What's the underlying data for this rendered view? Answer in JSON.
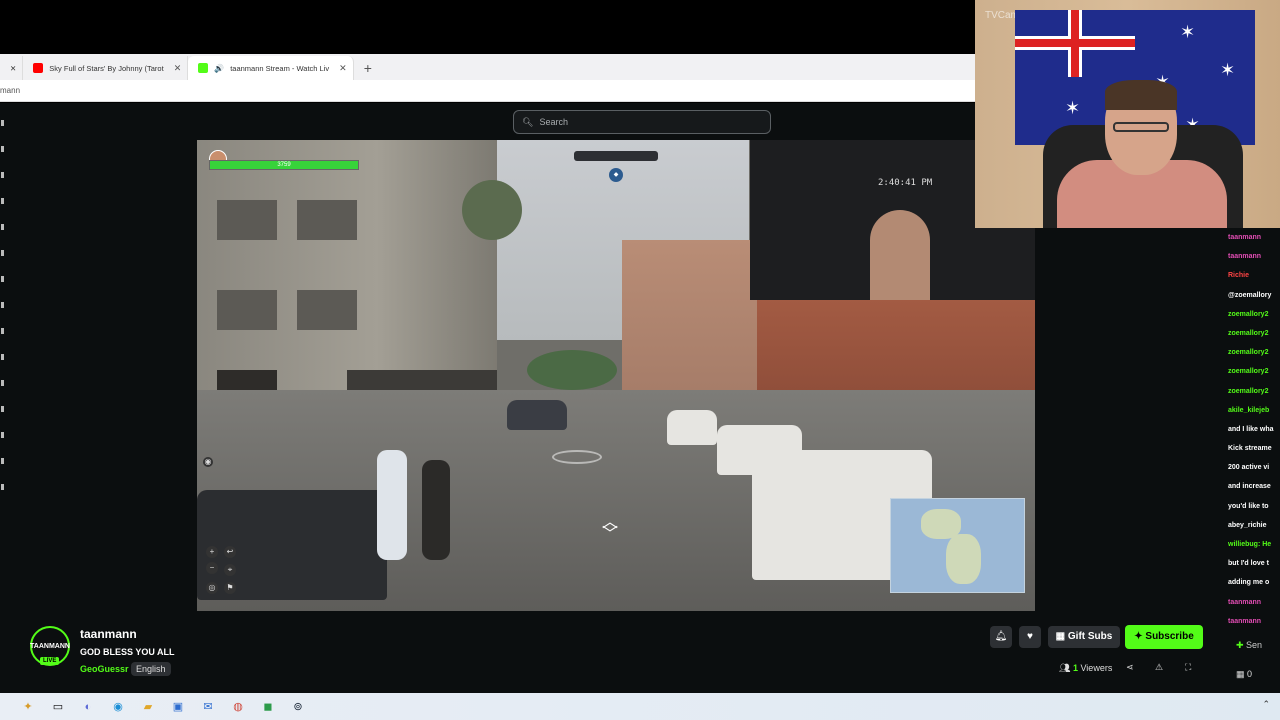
{
  "browser": {
    "tabs": [
      {
        "label": "Sky Full of Stars' By Johnny (Tarot",
        "fav_color": "#ff0000"
      },
      {
        "label": "taanmann Stream - Watch Liv",
        "fav_color": "#53fc18"
      }
    ],
    "new_tab_symbol": "+",
    "close_symbol": "✕",
    "address": "mann"
  },
  "search": {
    "placeholder": "Search",
    "icon": "search-icon"
  },
  "video": {
    "health_value": "3759",
    "clock": "2:40:41 PM"
  },
  "webcam": {
    "label": "TVCam"
  },
  "chat": {
    "lines": [
      {
        "text": "taanmann",
        "color": "#e14cb3"
      },
      {
        "text": "taanmann",
        "color": "#e14cb3"
      },
      {
        "text": "Richie",
        "color": "#ff4444"
      },
      {
        "text": "@zoemallory",
        "color": "#ffffff"
      },
      {
        "text": "zoemallory2",
        "color": "#53fc18"
      },
      {
        "text": "zoemallory2",
        "color": "#53fc18"
      },
      {
        "text": "zoemallory2",
        "color": "#53fc18"
      },
      {
        "text": "zoemallory2",
        "color": "#53fc18"
      },
      {
        "text": "zoemallory2",
        "color": "#53fc18"
      },
      {
        "text": "akile_kilejeb",
        "color": "#53fc18"
      },
      {
        "text": "and I like wha",
        "color": "#ffffff"
      },
      {
        "text": "Kick streame",
        "color": "#ffffff"
      },
      {
        "text": "200 active vi",
        "color": "#ffffff"
      },
      {
        "text": "and increase",
        "color": "#ffffff"
      },
      {
        "text": "you'd like to",
        "color": "#ffffff"
      },
      {
        "text": "abey_richie",
        "color": "#ffffff"
      },
      {
        "text": "williebug: He",
        "color": "#53fc18"
      },
      {
        "text": "but I'd love t",
        "color": "#ffffff"
      },
      {
        "text": "adding me o",
        "color": "#ffffff"
      },
      {
        "text": "taanmann",
        "color": "#e14cb3"
      },
      {
        "text": "taanmann",
        "color": "#e14cb3"
      }
    ],
    "send_label": "Sen",
    "count": "0"
  },
  "channel": {
    "avatar_text": "TAANMANN",
    "live": "LIVE",
    "name": "taanmann",
    "title": "GOD BLESS YOU ALL",
    "category": "GeoGuessr",
    "language": "English"
  },
  "actions": {
    "gift_label": "Gift Subs",
    "subscribe_label": "Subscribe",
    "viewers_count": "1",
    "viewers_label": "Viewers"
  },
  "colors": {
    "accent": "#53fc18",
    "page_bg": "#0b0e0f"
  }
}
